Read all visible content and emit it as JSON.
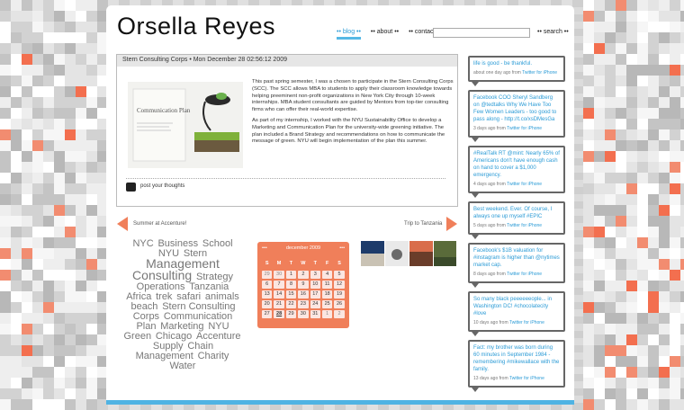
{
  "site": {
    "title": "Orsella Reyes"
  },
  "nav": {
    "items": [
      {
        "label": "•• blog ••"
      },
      {
        "label": "•• about ••"
      },
      {
        "label": "•• contact ••"
      }
    ],
    "search_label": "•• search ••"
  },
  "post": {
    "header": "Stern Consulting Corps • Mon December 28 02:56:12 2009",
    "paragraphs": [
      "This past spring semester, I was a chosen to participate in the Stern Consulting Corps (SCC). The SCC allows MBA to students to apply their classroom knowledge towards helping preeminent non-profit organizations in New York City through 10-week internships. MBA student consultants are guided by Mentors from top-tier consulting firms who can offer their real-world expertise.",
      "As part of my internship, I worked with the NYU Sustainability Office to develop a Marketing and Communication Plan for the university-wide greening initiative. The plan included a Brand Strategy and recommendations on how to communicate the message of green. NYU will begin implementation of the plan this summer."
    ],
    "image_caption": "Communication Plan",
    "comment_label": "post your thoughts"
  },
  "pagination": {
    "prev": "Summer at Accenture!",
    "next": "Trip to Tanzania"
  },
  "tags": [
    {
      "label": "NYC",
      "size": 11
    },
    {
      "label": "Business",
      "size": 11
    },
    {
      "label": "School",
      "size": 11
    },
    {
      "label": "NYU",
      "size": 11
    },
    {
      "label": "Stern",
      "size": 11
    },
    {
      "label": "Management",
      "size": 14
    },
    {
      "label": "Consulting",
      "size": 14
    },
    {
      "label": "Strategy",
      "size": 11
    },
    {
      "label": "Operations",
      "size": 11
    },
    {
      "label": "Tanzania",
      "size": 11
    },
    {
      "label": "Africa",
      "size": 11
    },
    {
      "label": "trek",
      "size": 11
    },
    {
      "label": "safari",
      "size": 11
    },
    {
      "label": "animals",
      "size": 11
    },
    {
      "label": "beach",
      "size": 11
    },
    {
      "label": "Stern Consulting Corps",
      "size": 11
    },
    {
      "label": "Communication Plan",
      "size": 11
    },
    {
      "label": "Marketing",
      "size": 11
    },
    {
      "label": "NYU Green",
      "size": 11
    },
    {
      "label": "Chicago",
      "size": 11
    },
    {
      "label": "Accenture",
      "size": 11
    },
    {
      "label": "Supply",
      "size": 11
    },
    {
      "label": "Chain Management",
      "size": 11
    },
    {
      "label": "Charity",
      "size": 11
    },
    {
      "label": "Water",
      "size": 11
    }
  ],
  "calendar": {
    "title": "december 2009",
    "prev": "•••",
    "next": "•••",
    "daynames": [
      "S",
      "M",
      "T",
      "W",
      "T",
      "F",
      "S"
    ],
    "weeks": [
      [
        "29",
        "30",
        "1",
        "2",
        "3",
        "4",
        "5"
      ],
      [
        "6",
        "7",
        "8",
        "9",
        "10",
        "11",
        "12"
      ],
      [
        "13",
        "14",
        "15",
        "16",
        "17",
        "18",
        "19"
      ],
      [
        "20",
        "21",
        "22",
        "23",
        "24",
        "25",
        "26"
      ],
      [
        "27",
        "28",
        "29",
        "30",
        "31",
        "1",
        "2"
      ]
    ],
    "today": "28"
  },
  "tweets": [
    {
      "text": "life is good - be thankful.",
      "meta": "about one day ago from",
      "source": "Twitter for iPhone"
    },
    {
      "text": "Facebook COO Sheryl Sandberg on @tedtalks Why We Have Too Few Women Leaders - too good to pass along - http://t.co/xsDMesGa",
      "meta": "3 days ago from",
      "source": "Twitter for iPhone"
    },
    {
      "text": "#RealTalk RT @mint: Nearly 65% of Americans don't have enough cash on hand to cover a $1,000 emergency.",
      "meta": "4 days ago from",
      "source": "Twitter for iPhone"
    },
    {
      "text": "Best weekend. Ever. Of course, I always one up myself #EPIC",
      "meta": "5 days ago from",
      "source": "Twitter for iPhone"
    },
    {
      "text": "Facebook's $1B valuation for #instagram is higher than @nytimes market cap.",
      "meta": "8 days ago from",
      "source": "Twitter for iPhone"
    },
    {
      "text": "So many black peeeeeeople... in Washington DC! #chocolatecity #love",
      "meta": "10 days ago from",
      "source": "Twitter for iPhone"
    },
    {
      "text": "Fact: my brother was born during 60 minutes in September 1984 - remembering #mikewallace with the family.",
      "meta": "13 days ago from",
      "source": "Twitter for iPhone"
    }
  ],
  "colors": {
    "accent": "#f07f5a",
    "link": "#2b9bd6",
    "bar": "#4fb3e3"
  }
}
